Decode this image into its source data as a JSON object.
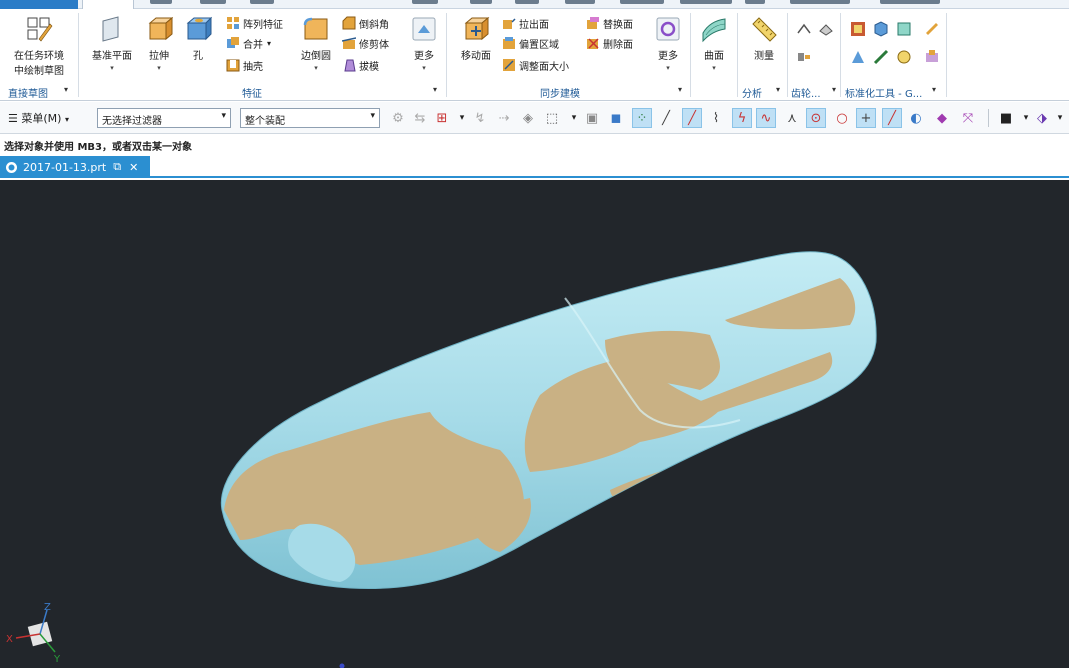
{
  "ribbon": {
    "direct_sketch": {
      "label_line1": "在任务环境",
      "label_line2": "中绘制草图",
      "group": "直接草图"
    },
    "feature": {
      "datum_plane": "基准平面",
      "extrude": "拉伸",
      "hole": "孔",
      "pattern": "阵列特征",
      "unite": "合并",
      "shell": "抽壳",
      "edge_blend": "边倒圆",
      "chamfer": "倒斜角",
      "trim_body": "修剪体",
      "draft": "拔模",
      "more": "更多",
      "group": "特征"
    },
    "sync": {
      "move_face": "移动面",
      "pull_face": "拉出面",
      "offset_region": "偏置区域",
      "resize_face": "调整面大小",
      "replace_face": "替换面",
      "delete_face": "删除面",
      "more": "更多",
      "group": "同步建模"
    },
    "surface": {
      "label": "曲面"
    },
    "analysis": {
      "measure": "测量",
      "group": "分析"
    },
    "gear": {
      "group": "齿轮..."
    },
    "std_tools": {
      "group": "标准化工具 - G..."
    }
  },
  "toolbar": {
    "menu_label": "菜单(M)",
    "filter_value": "无选择过滤器",
    "scope_value": "整个装配"
  },
  "status": {
    "text": "选择对象并使用 MB3，或者双击某一对象"
  },
  "doc_tab": {
    "name": "2017-01-13.prt"
  },
  "axes": {
    "z": "Z",
    "x": "X",
    "y": "Y"
  },
  "colors": {
    "accent": "#2b8fd1",
    "viewport_bg": "#22262b",
    "body_light_blue": "#a9dde9",
    "body_tan": "#c9b184"
  }
}
